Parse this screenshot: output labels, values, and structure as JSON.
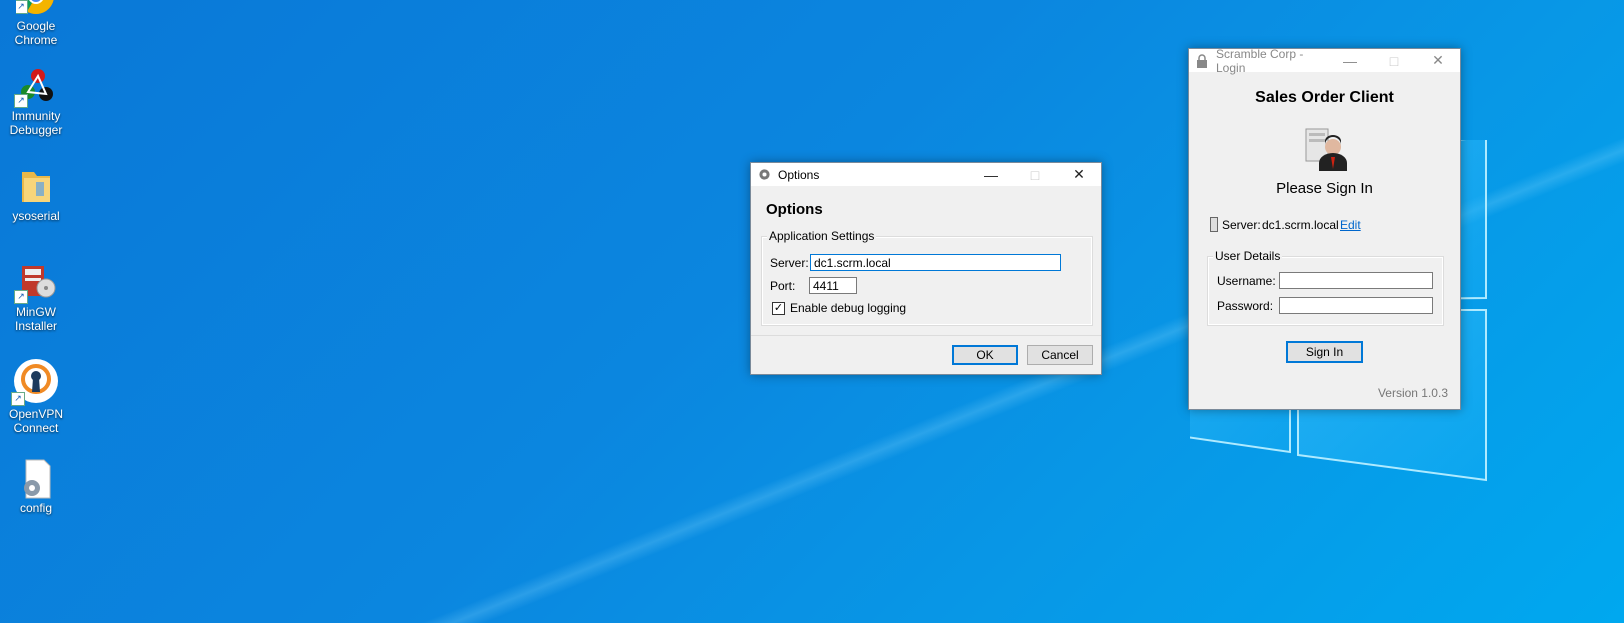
{
  "desktop": {
    "icons": [
      {
        "label_line1": "Google",
        "label_line2": "Chrome",
        "icon": "chrome-icon"
      },
      {
        "label_line1": "Immunity",
        "label_line2": "Debugger",
        "icon": "immunity-debugger-icon"
      },
      {
        "label_line1": "ysoserial",
        "label_line2": "",
        "icon": "folder-icon"
      },
      {
        "label_line1": "MinGW",
        "label_line2": "Installer",
        "icon": "mingw-installer-icon"
      },
      {
        "label_line1": "OpenVPN",
        "label_line2": "Connect",
        "icon": "openvpn-icon"
      },
      {
        "label_line1": "config",
        "label_line2": "",
        "icon": "config-file-icon"
      }
    ]
  },
  "options_window": {
    "title": "Options",
    "heading": "Options",
    "group_label": "Application Settings",
    "server_label": "Server:",
    "server_value": "dc1.scrm.local",
    "port_label": "Port:",
    "port_value": "4411",
    "debug_label": "Enable debug logging",
    "debug_checked": true,
    "ok_label": "OK",
    "cancel_label": "Cancel"
  },
  "login_window": {
    "title": "Scramble Corp - Login",
    "heading": "Sales Order Client",
    "subheading": "Please Sign In",
    "server_label": "Server:",
    "server_value": "dc1.scrm.local",
    "edit_link": "Edit",
    "group_label": "User Details",
    "username_label": "Username:",
    "username_value": "",
    "password_label": "Password:",
    "password_value": "",
    "signin_label": "Sign In",
    "version": "Version 1.0.3",
    "link_color": "#0066cc"
  }
}
